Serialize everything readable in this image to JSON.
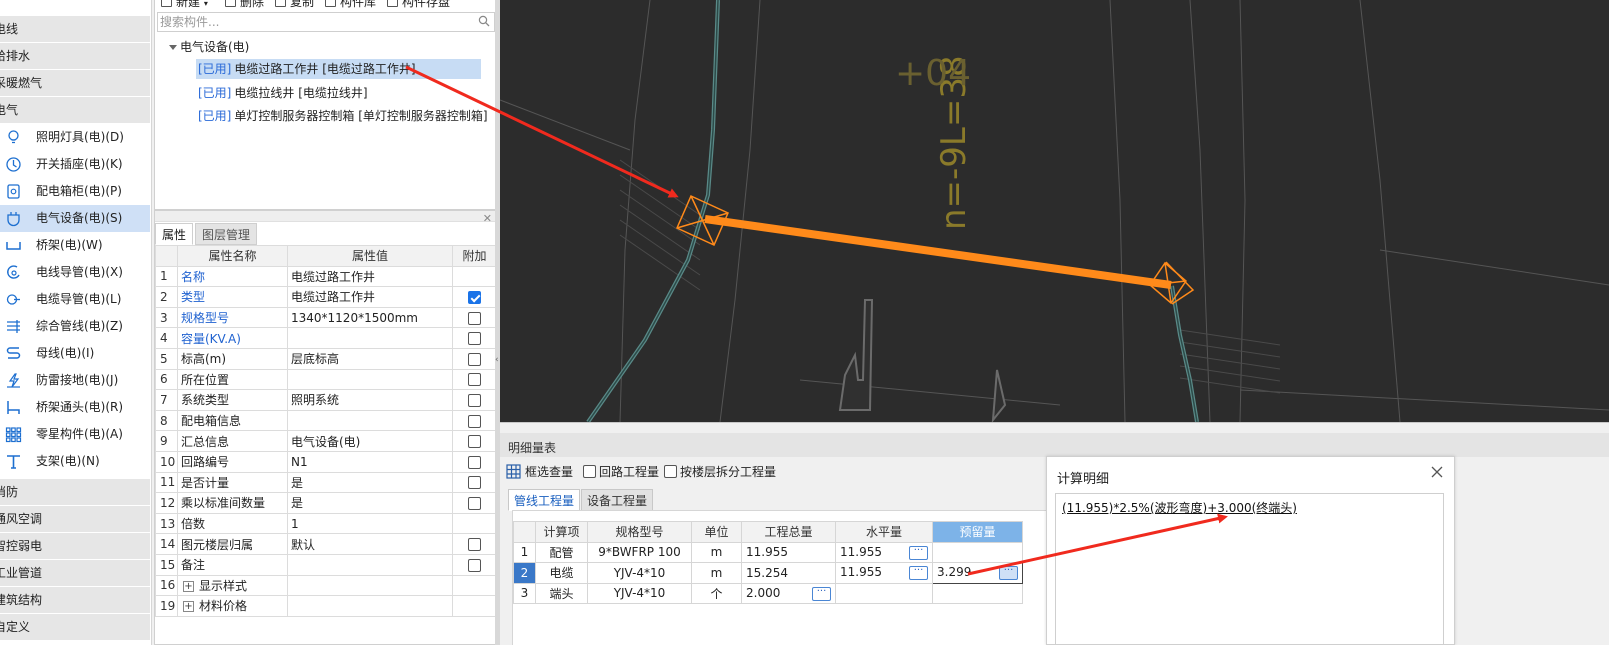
{
  "sidebar": {
    "categories": [
      {
        "label": "电线"
      },
      {
        "label": "给排水"
      },
      {
        "label": "采暖燃气"
      },
      {
        "label": "电气"
      }
    ],
    "items": [
      {
        "label": "照明灯具(电)(D)",
        "icon": "lightbulb-icon"
      },
      {
        "label": "开关插座(电)(K)",
        "icon": "switch-outlet-icon"
      },
      {
        "label": "配电箱柜(电)(P)",
        "icon": "distribution-box-icon"
      },
      {
        "label": "电气设备(电)(S)",
        "icon": "electrical-equipment-icon"
      },
      {
        "label": "桥架(电)(W)",
        "icon": "cable-tray-icon"
      },
      {
        "label": "电线导管(电)(X)",
        "icon": "wire-conduit-icon"
      },
      {
        "label": "电缆导管(电)(L)",
        "icon": "cable-conduit-icon"
      },
      {
        "label": "综合管线(电)(Z)",
        "icon": "combined-pipeline-icon"
      },
      {
        "label": "母线(电)(I)",
        "icon": "busbar-icon"
      },
      {
        "label": "防雷接地(电)(J)",
        "icon": "lightning-ground-icon"
      },
      {
        "label": "桥架通头(电)(R)",
        "icon": "tray-connector-icon"
      },
      {
        "label": "零星构件(电)(A)",
        "icon": "misc-component-icon"
      },
      {
        "label": "支架(电)(N)",
        "icon": "bracket-icon"
      }
    ],
    "bottom_categories": [
      {
        "label": "消防"
      },
      {
        "label": "通风空调"
      },
      {
        "label": "智控弱电"
      },
      {
        "label": "工业管道"
      },
      {
        "label": "建筑结构"
      },
      {
        "label": "自定义"
      }
    ]
  },
  "toolbar": {
    "new_label": "新建",
    "delete_label": "删除",
    "copy_label": "复制",
    "library_label": "构件库",
    "save_label": "构件存盘"
  },
  "search": {
    "placeholder": "搜索构件..."
  },
  "tree": {
    "root_label": "电气设备(电)",
    "nodes": [
      {
        "tag": "[已用]",
        "label": "电缆过路工作井 [电缆过路工作井]"
      },
      {
        "tag": "[已用]",
        "label": "电缆拉线井 [电缆拉线井]"
      },
      {
        "tag": "[已用]",
        "label": "单灯控制服务器控制箱 [单灯控制服务器控制箱]"
      }
    ]
  },
  "properties": {
    "tabs": [
      "属性",
      "图层管理"
    ],
    "headers": [
      "属性名称",
      "属性值",
      "附加"
    ],
    "rows": [
      {
        "num": "1",
        "name": "名称",
        "value": "电缆过路工作井"
      },
      {
        "num": "2",
        "name": "类型",
        "value": "电缆过路工作井"
      },
      {
        "num": "3",
        "name": "规格型号",
        "value": "1340*1120*1500mm"
      },
      {
        "num": "4",
        "name": "容量(KV.A)",
        "value": ""
      },
      {
        "num": "5",
        "name": "标高(m)",
        "value": "层底标高"
      },
      {
        "num": "6",
        "name": "所在位置",
        "value": ""
      },
      {
        "num": "7",
        "name": "系统类型",
        "value": "照明系统"
      },
      {
        "num": "8",
        "name": "配电箱信息",
        "value": ""
      },
      {
        "num": "9",
        "name": "汇总信息",
        "value": "电气设备(电)"
      },
      {
        "num": "10",
        "name": "回路编号",
        "value": "N1"
      },
      {
        "num": "11",
        "name": "是否计量",
        "value": "是"
      },
      {
        "num": "12",
        "name": "乘以标准间数量",
        "value": "是"
      },
      {
        "num": "13",
        "name": "倍数",
        "value": "1"
      },
      {
        "num": "14",
        "name": "图元楼层归属",
        "value": "默认"
      },
      {
        "num": "15",
        "name": "备注",
        "value": ""
      },
      {
        "num": "16",
        "name": "显示样式",
        "value": ""
      },
      {
        "num": "19",
        "name": "材料价格",
        "value": ""
      }
    ]
  },
  "canvas": {
    "annotation_text": "n=-9L=38",
    "annotation_text_2": "+04"
  },
  "quantity": {
    "title": "明细量表",
    "options": {
      "box_select_label": "框选查量",
      "loop_label": "回路工程量",
      "floor_split_label": "按楼层拆分工程量"
    },
    "tabs": [
      "管线工程量",
      "设备工程量"
    ],
    "headers": [
      "计算项",
      "规格型号",
      "单位",
      "工程总量",
      "水平量",
      "预留量"
    ],
    "rows": [
      {
        "num": "1",
        "item": "配管",
        "spec": "9*BWFRP 100",
        "unit": "m",
        "total": "11.955",
        "horizontal": "11.955",
        "reserved": ""
      },
      {
        "num": "2",
        "item": "电缆",
        "spec": "YJV-4*10",
        "unit": "m",
        "total": "15.254",
        "horizontal": "11.955",
        "reserved": "3.299"
      },
      {
        "num": "3",
        "item": "端头",
        "spec": "YJV-4*10",
        "unit": "个",
        "total": "2.000",
        "horizontal": "",
        "reserved": ""
      }
    ],
    "dots_label": "···"
  },
  "calc_detail": {
    "title": "计算明细",
    "formula": "(11.955)*2.5%(波形弯度)+3.000(终端头)"
  },
  "colors": {
    "accent_blue": "#1a73e8",
    "cad_background": "#2c2c2c",
    "cable_orange": "#ff8a1a",
    "arrow_red": "#f02a1e"
  }
}
